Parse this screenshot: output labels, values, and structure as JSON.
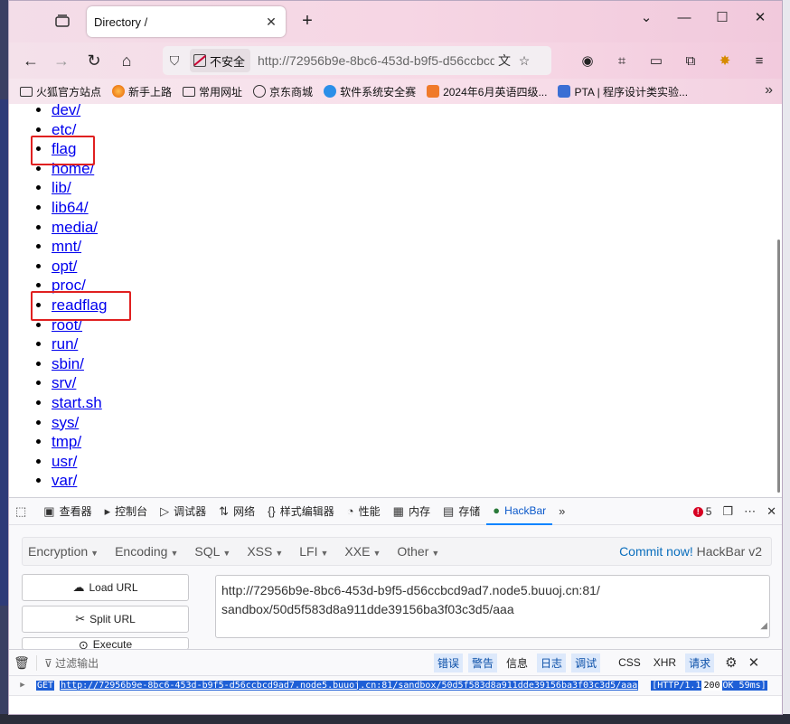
{
  "browser": {
    "tab_title": "Directory /",
    "url": "http://72956b9e-8bc6-453d-b9f5-d56ccbcd9ad7.node5.buuoj.cn:81/sandbox/50d5f583d8a911dde39156ba3f03c3d5/aaa",
    "url_visible": "http://72956b9e-8bc6-453d-b9f5-d56ccbcd9ad7.node5.buuoj.cn:81",
    "insecure_label": "不安全",
    "bookmarks": [
      "火狐官方站点",
      "新手上路",
      "常用网址",
      "京东商城",
      "软件系统安全赛",
      "2024年6月英语四级...",
      "PTA | 程序设计类实验..."
    ]
  },
  "directory": {
    "entries": [
      "dev/",
      "etc/",
      "flag",
      "home/",
      "lib/",
      "lib64/",
      "media/",
      "mnt/",
      "opt/",
      "proc/",
      "readflag",
      "root/",
      "run/",
      "sbin/",
      "srv/",
      "start.sh",
      "sys/",
      "tmp/",
      "usr/",
      "var/"
    ],
    "highlighted": [
      "flag",
      "readflag"
    ]
  },
  "devtools": {
    "tabs": [
      "查看器",
      "控制台",
      "调试器",
      "网络",
      "样式编辑器",
      "性能",
      "内存",
      "存储",
      "HackBar"
    ],
    "active_tab": "HackBar",
    "error_count": "5"
  },
  "hackbar": {
    "menus": [
      "Encryption",
      "Encoding",
      "SQL",
      "XSS",
      "LFI",
      "XXE",
      "Other"
    ],
    "commit_link": "Commit now!",
    "version": "HackBar v2",
    "load_url": "Load URL",
    "split_url": "Split URL",
    "execute": "Execute",
    "url_text": "http://72956b9e-8bc6-453d-b9f5-d56ccbcd9ad7.node5.buuoj.cn:81/\nsandbox/50d5f583d8a911dde39156ba3f03c3d5/aaa"
  },
  "console": {
    "filter_placeholder": "过滤输出",
    "filters": [
      "错误",
      "警告",
      "信息",
      "日志",
      "调试",
      "CSS",
      "XHR",
      "请求"
    ],
    "active_filters": [
      "错误",
      "警告",
      "日志",
      "调试",
      "请求"
    ],
    "log": {
      "method": "GET",
      "url": "http://72956b9e-8bc6-453d-b9f5-d56ccbcd9ad7.node5.buuoj.cn:81/sandbox/50d5f583d8a911dde39156ba3f03c3d5/aaa",
      "protocol": "[HTTP/1.1",
      "status": "200",
      "status_text": "OK 59ms]"
    }
  },
  "colors": {
    "link": "#0000ee",
    "highlight_box": "#e02020",
    "accent": "#0a84ff"
  }
}
